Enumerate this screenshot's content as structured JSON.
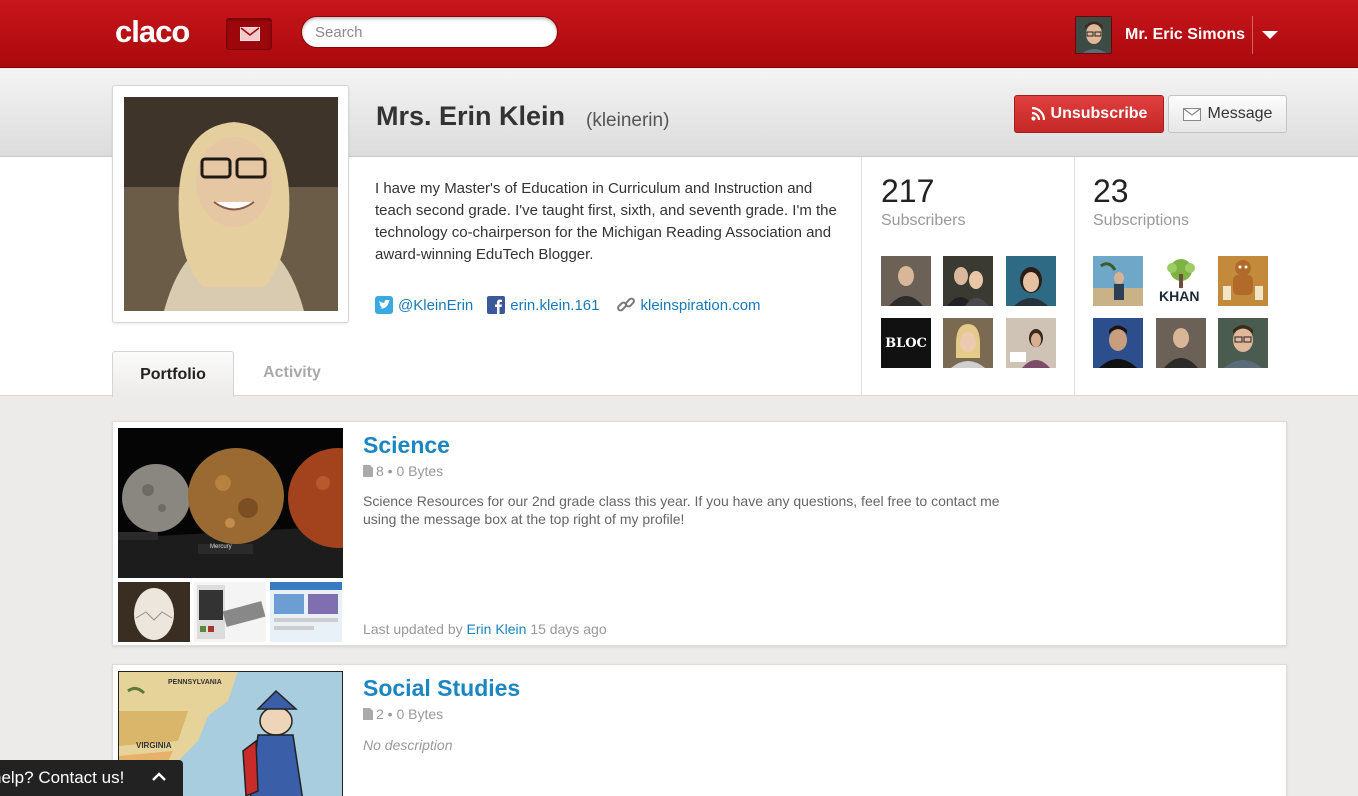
{
  "nav": {
    "logo": "claco",
    "search_placeholder": "Search",
    "user_name": "Mr. Eric Simons"
  },
  "profile": {
    "name": "Mrs. Erin Klein",
    "username": "(kleinerin)",
    "bio": "I have my Master's of Education in Curriculum and Instruction and teach second grade. I've taught first, sixth, and seventh grade. I'm the technology co-chairperson for the Michigan Reading Association and award-winning EduTech Blogger.",
    "unsubscribe_label": "Unsubscribe",
    "message_label": "Message",
    "links": {
      "twitter": "@KleinErin",
      "facebook": "erin.klein.161",
      "website": "kleinspiration.com"
    }
  },
  "stats": {
    "subscribers_count": "217",
    "subscribers_label": "Subscribers",
    "subscriptions_count": "23",
    "subscriptions_label": "Subscriptions",
    "subscription_thumb_text": "KHAN",
    "subscriber_thumb_text": "BLOC"
  },
  "tabs": {
    "portfolio": "Portfolio",
    "activity": "Activity"
  },
  "portfolio": [
    {
      "title": "Science",
      "meta": "8 • 0 Bytes",
      "description": "Science Resources for our 2nd grade class this year. If you have any questions, feel free to contact me using the message box at the top right of my profile!",
      "updated_prefix": "Last updated by",
      "updated_author": "Erin Klein",
      "updated_suffix": "15 days ago",
      "planet_label_1": "Mercury"
    },
    {
      "title": "Social Studies",
      "meta": "2 • 0 Bytes",
      "description": "No description"
    }
  ],
  "help": {
    "label": "help? Contact us!"
  },
  "colors": {
    "brand_red": "#b30d11",
    "link_blue": "#1a86c2",
    "unsubscribe_red": "#d33533"
  }
}
